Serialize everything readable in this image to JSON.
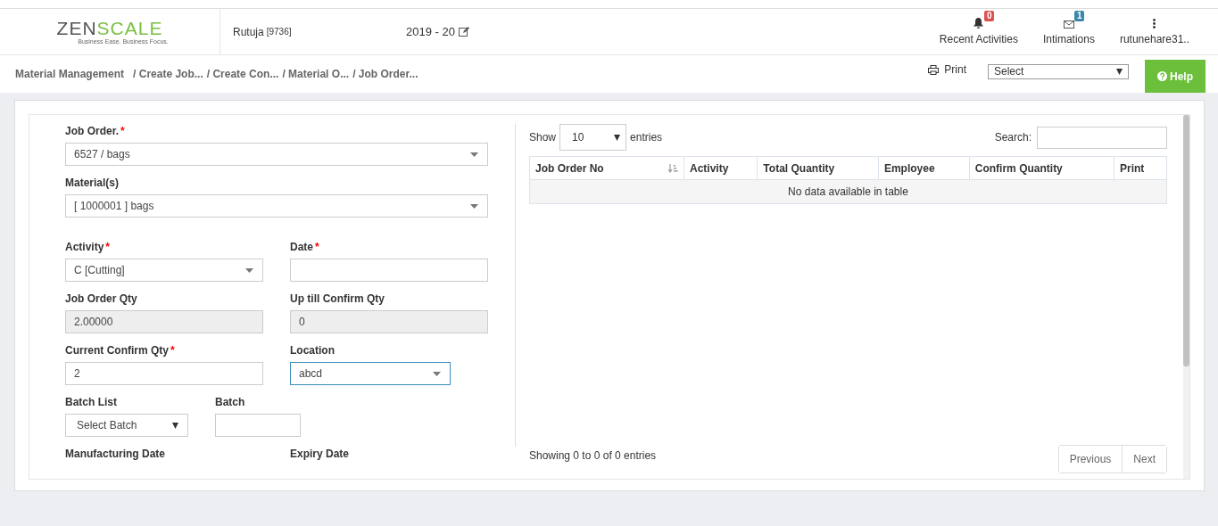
{
  "header": {
    "logo": {
      "text_dark": "ZEN",
      "text_brand": "SCALE",
      "tagline": "Business Ease. Business Focus."
    },
    "user": {
      "name": "Rutuja",
      "code": "[9736]"
    },
    "fiscal_year": "2019 - 20",
    "nav_items": [
      {
        "kind": "bell",
        "label": "Recent Activities",
        "badge": "0",
        "color": "#d9534f"
      },
      {
        "kind": "mail",
        "label": "Intimations",
        "badge": "1",
        "color": "#3a87ad"
      },
      {
        "kind": "menu",
        "label": "rutunehare31.."
      }
    ]
  },
  "breadcrumb": {
    "items": [
      "Material Management",
      "/ Create Job...",
      "/ Create Con...",
      "/ Material O...",
      "/ Job Order..."
    ]
  },
  "toolbar": {
    "print": "Print",
    "select": "Select",
    "help": "Help"
  },
  "form": {
    "rows": [
      {
        "kind": "single",
        "fields": [
          {
            "kind": "select",
            "label": "Job Order.",
            "required_mark": "*",
            "value": "6527 / bags"
          }
        ]
      },
      {
        "kind": "single",
        "fields": [
          {
            "kind": "select",
            "label": "Material(s)",
            "value": "[ 1000001 ] bags"
          }
        ]
      },
      {
        "kind": "pair",
        "fields": [
          {
            "kind": "select",
            "label": "Activity",
            "required_mark": "*",
            "value": "C [Cutting]"
          },
          {
            "kind": "text",
            "label": "Date",
            "required_mark": "*"
          }
        ]
      },
      {
        "kind": "pair",
        "fields": [
          {
            "kind": "readonly",
            "label": "Job Order Qty",
            "value": "2.00000"
          },
          {
            "kind": "readonly",
            "label": "Up till Confirm Qty",
            "value": "0"
          }
        ]
      },
      {
        "kind": "pair",
        "fields": [
          {
            "kind": "text",
            "label": "Current Confirm Qty",
            "required_mark": "*",
            "value": "2"
          },
          {
            "kind": "select",
            "label": "Location",
            "value": "abcd",
            "focused": true
          }
        ]
      },
      {
        "kind": "compact",
        "fields": [
          {
            "kind": "native-select",
            "label": "Batch List",
            "value": "Select Batch"
          },
          {
            "kind": "text",
            "label": "Batch"
          }
        ]
      },
      {
        "kind": "pair",
        "fields": [
          {
            "kind": "label",
            "label": "Manufacturing Date"
          },
          {
            "kind": "label",
            "label": "Expiry Date"
          }
        ]
      }
    ]
  },
  "table": {
    "show_label": "Show",
    "page_size": "10",
    "entries_label": "entries",
    "search_label": "Search:",
    "columns": [
      "Job Order No",
      "Activity",
      "Total Quantity",
      "Employee",
      "Confirm Quantity",
      "Print"
    ],
    "empty_message": "No data available in table",
    "info": "Showing 0 to 0 of 0 entries",
    "pagination": [
      "Previous",
      "Next"
    ]
  }
}
